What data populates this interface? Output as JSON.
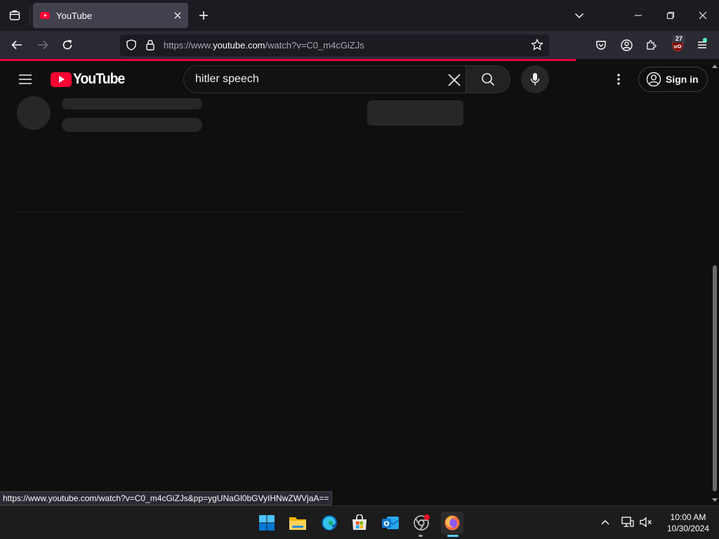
{
  "browser": {
    "tab_title": "YouTube",
    "url_prefix": "https://www.",
    "url_domain": "youtube.com",
    "url_path": "/watch?v=C0_m4cGiZJs",
    "extension_badge": "27",
    "status_url": "https://www.youtube.com/watch?v=C0_m4cGiZJs&pp=ygUNaGl0bGVyIHNwZWVjaA==",
    "colors": {
      "tab_bg": "#42414d",
      "toolbar_bg": "#2b2a33",
      "loading_bar": "#e5003a"
    }
  },
  "youtube": {
    "logo_text": "YouTube",
    "search_value": "hitler speech",
    "sign_in_label": "Sign in",
    "colors": {
      "brand_red": "#ff0033",
      "page_bg": "#0f0f0f",
      "skeleton": "#272727"
    }
  },
  "taskbar": {
    "apps": [
      "start",
      "file-explorer",
      "edge",
      "microsoft-store",
      "outlook",
      "chrome",
      "firefox"
    ],
    "time": "10:00 AM",
    "date": "10/30/2024"
  }
}
